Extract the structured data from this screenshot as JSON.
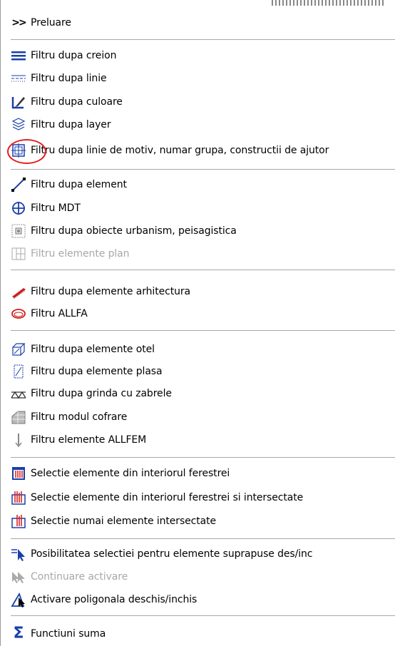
{
  "menu": {
    "items": [
      {
        "label": "Preluare",
        "icon": "double-arrow-right-icon"
      },
      {
        "label": "Filtru dupa creion",
        "icon": "pen-thickness-icon"
      },
      {
        "label": "Filtru dupa linie",
        "icon": "line-type-icon"
      },
      {
        "label": "Filtru dupa culoare",
        "icon": "color-brush-icon"
      },
      {
        "label": "Filtru dupa layer",
        "icon": "layers-icon"
      },
      {
        "label": "Filtru dupa linie de motiv, numar grupa, constructii de ajutor",
        "icon": "pattern-line-icon"
      },
      {
        "label": "Filtru dupa element",
        "icon": "diagonal-line-icon"
      },
      {
        "label": "Filtru MDT",
        "icon": "crosshair-circle-icon"
      },
      {
        "label": "Filtru dupa obiecte urbanism, peisagistica",
        "icon": "urban-objects-icon"
      },
      {
        "label": "Filtru elemente plan",
        "icon": "plan-elements-icon",
        "disabled": true
      },
      {
        "label": "Filtru dupa elemente arhitectura",
        "icon": "architecture-wall-icon"
      },
      {
        "label": "Filtru ALLFA",
        "icon": "allfa-ellipse-icon"
      },
      {
        "label": "Filtru dupa elemente otel",
        "icon": "steel-elements-icon"
      },
      {
        "label": "Filtru dupa elemente plasa",
        "icon": "mesh-elements-icon"
      },
      {
        "label": "Filtru dupa grinda cu zabrele",
        "icon": "truss-beam-icon"
      },
      {
        "label": "Filtru modul cofrare",
        "icon": "formwork-icon"
      },
      {
        "label": "Filtru elemente ALLFEM",
        "icon": "allfem-icon"
      },
      {
        "label": "Selectie elemente din interiorul ferestrei",
        "icon": "window-select-inside-icon"
      },
      {
        "label": "Selectie elemente din interiorul ferestrei si intersectate",
        "icon": "window-select-crossing-icon"
      },
      {
        "label": "Selectie numai elemente intersectate",
        "icon": "window-select-intersected-icon"
      },
      {
        "label": "Posibilitatea selectiei pentru elemente suprapuse des/inc",
        "icon": "overlap-select-arrow-icon"
      },
      {
        "label": "Continuare activare",
        "icon": "continue-activation-icon",
        "disabled": true
      },
      {
        "label": "Activare poligonala deschis/inchis",
        "icon": "polygon-activation-icon"
      },
      {
        "label": "Functiuni suma",
        "icon": "sigma-icon"
      }
    ]
  },
  "colors": {
    "separator": "#a8a8a8",
    "disabled_text": "#a8a8a8",
    "annotation_circle": "#e31f1f",
    "icon_blue": "#1a3fa8",
    "icon_red": "#d21b1b"
  }
}
